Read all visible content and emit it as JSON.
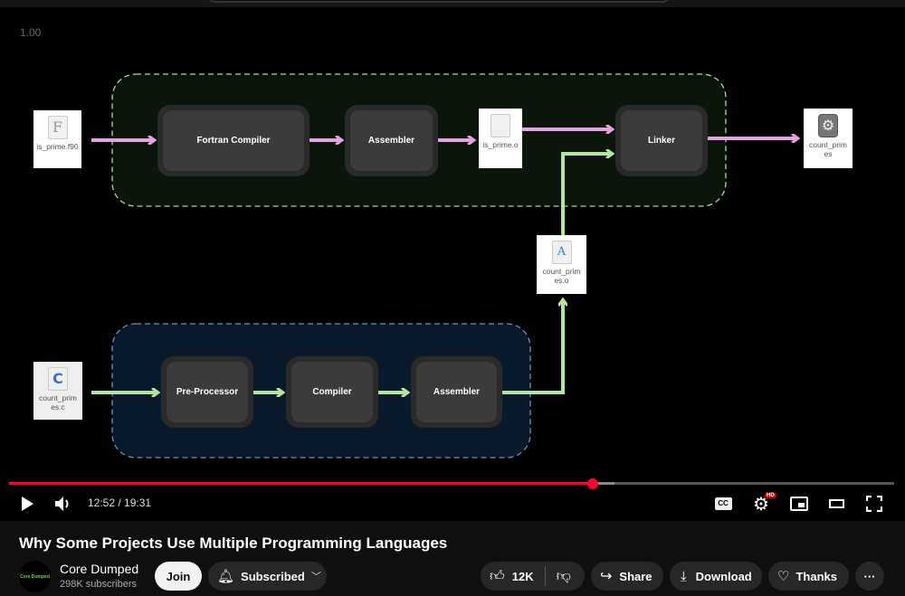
{
  "player": {
    "speed_overlay": "1.00",
    "time": "12:52 / 19:31",
    "progress_percent": 66,
    "buffered_percent": 68.4,
    "hd_badge": "HD"
  },
  "diagram": {
    "fortran_group": {
      "nodes": [
        "Fortran Compiler",
        "Assembler",
        "Linker"
      ]
    },
    "c_group": {
      "nodes": [
        "Pre-Processor",
        "Compiler",
        "Assembler"
      ]
    },
    "files": {
      "f90": "is_prime.f90",
      "obj_f": "is_prime.o",
      "exe": "count_prim es",
      "obj_c": "count_prim es.o",
      "c_src": "count_prim es.c"
    },
    "colors": {
      "fortran_arrow": "#e8a0e0",
      "c_arrow": "#b4e4a4"
    }
  },
  "video": {
    "title": "Why Some Projects Use Multiple Programming Languages"
  },
  "channel": {
    "name": "Core Dumped",
    "subscribers": "298K subscribers",
    "avatar_text": "Core Dumped"
  },
  "actions": {
    "join": "Join",
    "subscribed": "Subscribed",
    "likes": "12K",
    "share": "Share",
    "download": "Download",
    "thanks": "Thanks"
  }
}
